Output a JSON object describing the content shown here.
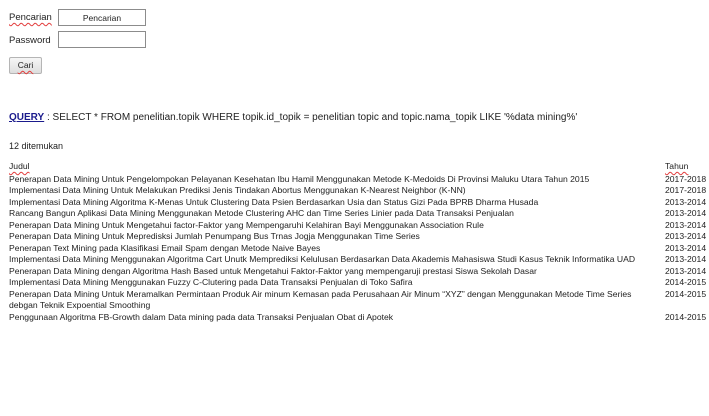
{
  "form": {
    "search_label": "Pencarian",
    "search_value": "Pencarian",
    "password_label": "Password",
    "password_value": "",
    "submit_label": "Cari"
  },
  "query": {
    "label": "QUERY",
    "text": " : SELECT * FROM penelitian.topik WHERE topik.id_topik = penelitian topic and topic.nama_topik LIKE '%data mining%'"
  },
  "results": {
    "count_text": "12 ditemukan",
    "headers": {
      "title": "Judul",
      "year": "Tahun"
    },
    "rows": [
      {
        "title": "Penerapan Data Mining Untuk Pengelompokan Pelayanan Kesehatan Ibu Hamil Menggunakan Metode K-Medoids Di Provinsi Maluku Utara Tahun 2015",
        "year": "2017-2018"
      },
      {
        "title": "Implementasi Data Mining Untuk Melakukan Prediksi Jenis Tindakan Abortus Menggunakan K-Nearest Neighbor (K-NN)",
        "year": "2017-2018"
      },
      {
        "title": "Implementasi Data Mining Algoritma K-Menas Untuk Clustering Data Psien Berdasarkan Usia dan Status Gizi Pada BPRB Dharma Husada",
        "year": "2013-2014"
      },
      {
        "title": "Rancang Bangun Aplikasi Data Mining Menggunakan Metode Clustering AHC dan Time Series Linier pada Data Transaksi Penjualan",
        "year": "2013-2014"
      },
      {
        "title": "Penerapan Data Mining Untuk Mengetahui factor-Faktor yang Mempengaruhi Kelahiran Bayi Menggunakan Association Rule",
        "year": "2013-2014"
      },
      {
        "title": "Penerapan Data Mining Untuk Mepredisksi Jumlah Penumpang Bus Trnas Jogja Menggunakan Time Series",
        "year": "2013-2014"
      },
      {
        "title": "Penerapan Text Mining pada Klasifikasi Email Spam dengan Metode Naive Bayes",
        "year": "2013-2014"
      },
      {
        "title": "Implementasi Data Mining Menggunakan Algoritma Cart Unutk Memprediksi Kelulusan Berdasarkan Data Akademis Mahasiswa Studi Kasus Teknik Informatika UAD",
        "year": "2013-2014"
      },
      {
        "title": "Penerapan Data Mining dengan Algoritma Hash Based untuk Mengetahui Faktor-Faktor yang mempengaruji prestasi Siswa Sekolah Dasar",
        "year": "2013-2014"
      },
      {
        "title": "Implementasi Data Mining Menggunakan Fuzzy C-Clutering pada Data Transaksi Penjualan di Toko Safira",
        "year": "2014-2015"
      },
      {
        "title": "Penerapan Data Mining Untuk Meramalkan Permintaan Produk Air minum Kemasan pada Perusahaan Air Minum “XYZ” dengan Menggunakan Metode Time Series debgan Teknik Expoential Smoothing",
        "year": "2014-2015"
      },
      {
        "title": "Penggunaan Algoritma FB-Growth dalam Data mining pada data Transaksi Penjualan Obat di Apotek",
        "year": "2014-2015"
      }
    ]
  }
}
